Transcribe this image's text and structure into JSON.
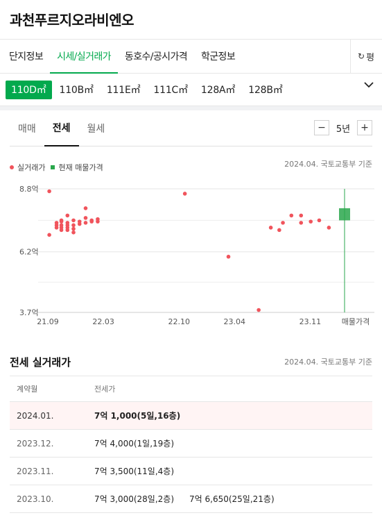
{
  "complex_title": "과천푸르지오라비엔오",
  "main_tabs": [
    {
      "label": "단지정보",
      "active": false
    },
    {
      "label": "시세/실거래가",
      "active": true
    },
    {
      "label": "동호수/공시가격",
      "active": false
    },
    {
      "label": "학군정보",
      "active": false
    }
  ],
  "refresh_label": "평",
  "unit_types": [
    {
      "label": "110D㎡",
      "active": true
    },
    {
      "label": "110B㎡",
      "active": false
    },
    {
      "label": "111E㎡",
      "active": false
    },
    {
      "label": "111C㎡",
      "active": false
    },
    {
      "label": "128A㎡",
      "active": false
    },
    {
      "label": "128B㎡",
      "active": false
    }
  ],
  "trade_tabs": [
    {
      "label": "매매",
      "active": false
    },
    {
      "label": "전세",
      "active": true
    },
    {
      "label": "월세",
      "active": false
    }
  ],
  "period": {
    "minus": "−",
    "value": "5년",
    "plus": "+"
  },
  "legend": {
    "actual_label": "실거래가",
    "listing_label": "현재 매물가격",
    "source": "2024.04. 국토교통부 기준",
    "actual_color": "#f0545c",
    "listing_color": "#2aa74c"
  },
  "chart_data": {
    "type": "scatter",
    "y_unit": "억",
    "ylim": [
      3.7,
      8.8
    ],
    "y_ticks": [
      {
        "v": 8.8,
        "label": "8.8억"
      },
      {
        "v": 6.2,
        "label": "6.2억"
      },
      {
        "v": 3.7,
        "label": "3.7억"
      }
    ],
    "x_ticks": [
      {
        "t": 2021.708,
        "label": "21.09"
      },
      {
        "t": 2022.167,
        "label": "22.03"
      },
      {
        "t": 2022.792,
        "label": "22.10"
      },
      {
        "t": 2023.25,
        "label": "23.04"
      },
      {
        "t": 2023.875,
        "label": "23.11"
      }
    ],
    "xlim": [
      2021.708,
      2024.125
    ],
    "listing_label": "매물가격",
    "listing_range": [
      7.5,
      8.0
    ],
    "points": [
      [
        2021.72,
        8.7
      ],
      [
        2021.72,
        6.9
      ],
      [
        2021.78,
        7.4
      ],
      [
        2021.78,
        7.3
      ],
      [
        2021.78,
        7.2
      ],
      [
        2021.82,
        7.5
      ],
      [
        2021.82,
        7.3
      ],
      [
        2021.82,
        7.2
      ],
      [
        2021.82,
        7.1
      ],
      [
        2021.82,
        7.45
      ],
      [
        2021.87,
        7.4
      ],
      [
        2021.87,
        7.2
      ],
      [
        2021.87,
        7.1
      ],
      [
        2021.87,
        7.7
      ],
      [
        2021.87,
        7.3
      ],
      [
        2021.92,
        7.5
      ],
      [
        2021.92,
        7.3
      ],
      [
        2021.92,
        7.0
      ],
      [
        2021.92,
        7.15
      ],
      [
        2021.97,
        7.35
      ],
      [
        2021.97,
        7.45
      ],
      [
        2022.02,
        7.6
      ],
      [
        2022.02,
        8.0
      ],
      [
        2022.02,
        7.4
      ],
      [
        2022.07,
        7.45
      ],
      [
        2022.07,
        7.5
      ],
      [
        2022.12,
        7.55
      ],
      [
        2022.12,
        7.45
      ],
      [
        2022.84,
        8.6
      ],
      [
        2023.2,
        6.0
      ],
      [
        2023.45,
        3.8
      ],
      [
        2023.55,
        7.2
      ],
      [
        2023.62,
        7.1
      ],
      [
        2023.65,
        7.4
      ],
      [
        2023.72,
        7.7
      ],
      [
        2023.8,
        7.4
      ],
      [
        2023.8,
        7.7
      ],
      [
        2023.88,
        7.45
      ],
      [
        2023.95,
        7.5
      ],
      [
        2024.03,
        7.2
      ]
    ]
  },
  "deals_section": {
    "title": "전세 실거래가",
    "source": "2024.04. 국토교통부 기준",
    "col_month": "계약월",
    "col_price": "전세가",
    "rows": [
      {
        "month": "2024.01.",
        "prices": [
          "7억 1,000(5일,16층)"
        ],
        "highlight": true
      },
      {
        "month": "2023.12.",
        "prices": [
          "7억 4,000(1일,19층)"
        ],
        "highlight": false
      },
      {
        "month": "2023.11.",
        "prices": [
          "7억 3,500(11일,4층)"
        ],
        "highlight": false
      },
      {
        "month": "2023.10.",
        "prices": [
          "7억 3,000(28일,2층)",
          "7억 6,650(25일,21층)"
        ],
        "highlight": false
      }
    ]
  }
}
